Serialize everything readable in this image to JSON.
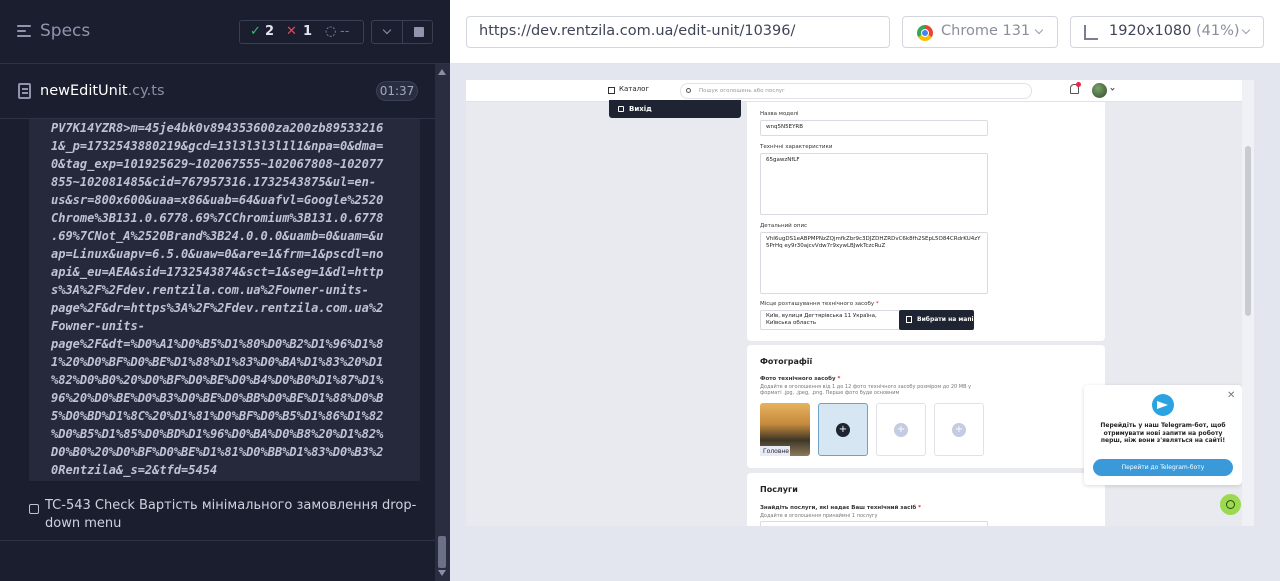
{
  "sidebar": {
    "title": "Specs",
    "stats": {
      "passed": "2",
      "failed": "1",
      "pending": "--"
    },
    "spec_file": {
      "name": "newEditUnit",
      "ext": ".cy.ts",
      "duration": "01:37"
    },
    "log_lines": [
      "PV7K14YZR8>m=45je4bk0v894353600za200zb89533216",
      "1&_p=1732543880219&gcd=13l3l3l3l1l1&npa=0&dma=",
      "0&tag_exp=101925629~102067555~102067808~102077",
      "855~102081485&cid=767957316.1732543875&ul=en-",
      "us&sr=800x600&uaa=x86&uab=64&uafvl=Google%2520",
      "Chrome%3B131.0.6778.69%7CChromium%3B131.0.6778",
      ".69%7CNot_A%2520Brand%3B24.0.0.0&uamb=0&uam=&u",
      "ap=Linux&uapv=6.5.0&uaw=0&are=1&frm=1&pscdl=no",
      "api&_eu=AEA&sid=1732543874&sct=1&seg=1&dl=http",
      "s%3A%2F%2Fdev.rentzila.com.ua%2Fowner-units-",
      "page%2F&dr=https%3A%2F%2Fdev.rentzila.com.ua%2",
      "Fowner-units-",
      "page%2F&dt=%D0%A1%D0%B5%D1%80%D0%B2%D1%96%D1%8",
      "1%20%D0%BF%D0%BE%D1%88%D1%83%D0%BA%D1%83%20%D1",
      "%82%D0%B0%20%D0%BF%D0%BE%D0%B4%D0%B0%D1%87%D1%",
      "96%20%D0%BE%D0%B3%D0%BE%D0%BB%D0%BE%D1%88%D0%B",
      "5%D0%BD%D1%8C%20%D1%81%D0%BF%D0%B5%D1%86%D1%82",
      "%D0%B5%D1%85%D0%BD%D1%96%D0%BA%D0%B8%20%D1%82%",
      "D0%B0%20%D0%BF%D0%BE%D1%81%D0%BB%D1%83%D0%B3%2",
      "0Rentzila&_s=2&tfd=5454"
    ],
    "test_title": "TC-543 Check Вартість мінімального замовлення drop-down menu"
  },
  "browser_bar": {
    "url": "https://dev.rentzila.com.ua/edit-unit/10396/",
    "browser": "Chrome 131",
    "viewport": "1920x1080",
    "zoom": "(41%)"
  },
  "aut": {
    "nav": {
      "catalog": "Каталог",
      "search_placeholder": "Пошук оголошень або послуг"
    },
    "logout": "Вихід",
    "model_label": "Назва моделі",
    "model_value": "wnq5N5EYRB",
    "tech_label": "Технічні характеристики",
    "tech_value": "65gawzNfLF",
    "desc_label": "Детальний опис",
    "desc_value": "VhI6ugDS1eABPMPNzZQjmfkZbr9c3DJZDHZRDvC6k8fh2SEpL5O84CRdrKU4zY5PrHq ey9r30ajcvVdw7r9xywLBJwkTczcRuZ",
    "location_label": "Місце розташування технічного засобу",
    "location_value": "Київ, вулиця Дегтярівська 11 Україна, Київська область",
    "map_button": "Вибрати на мапі",
    "photos_heading": "Фотографії",
    "photos_label": "Фото технічного засобу",
    "photos_hint": "Додайте в оголошення від 1 до 12 фото технічного засобу розміром до 20 МВ у форматі .jpg, .jpeg, .png. Перше фото буде основним",
    "main_photo_tag": "Головне",
    "services_heading": "Послуги",
    "services_label": "Знайдіть послуги, які надає Ваш технічний засіб",
    "services_hint": "Додайте в оголошення принаймні 1 послугу",
    "telegram": {
      "text": "Перейдіть у наш Telegram-бот, щоб отримувати нові запити на роботу перш, ніж вони з'являться на сайті!",
      "button": "Перейти до Telegram-боту"
    }
  }
}
